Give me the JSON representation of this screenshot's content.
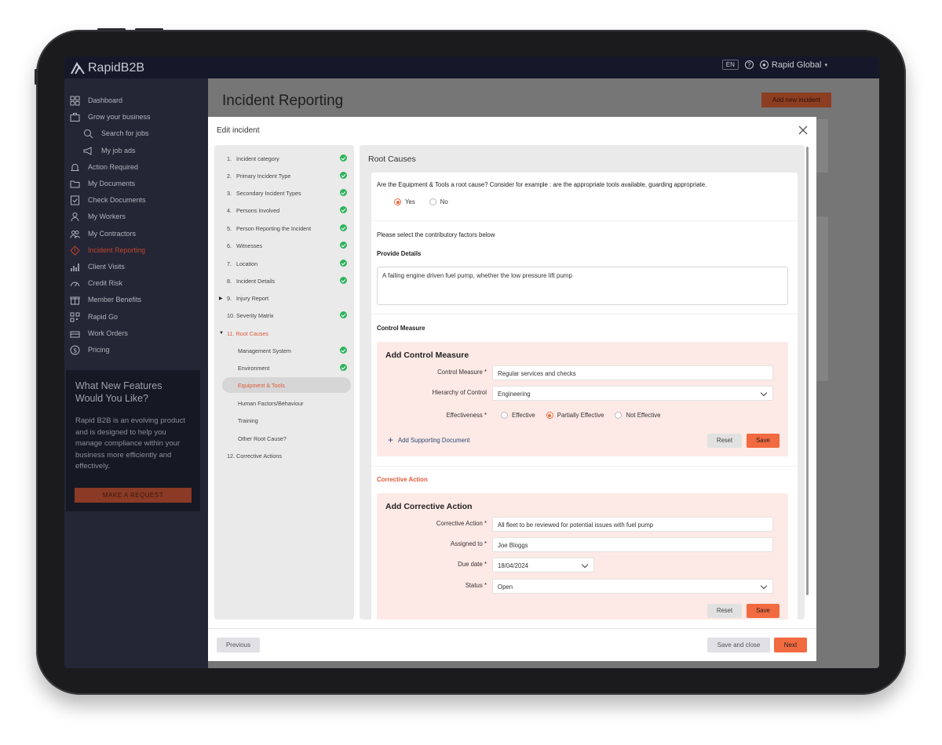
{
  "app": {
    "logo_text": "RapidB2B",
    "lang": "EN",
    "help": "?",
    "account": "Rapid Global"
  },
  "sidebar": {
    "items": [
      {
        "label": "Dashboard"
      },
      {
        "label": "Grow your business"
      },
      {
        "label": "Search for jobs"
      },
      {
        "label": "My job ads"
      },
      {
        "label": "Action Required"
      },
      {
        "label": "My Documents"
      },
      {
        "label": "Check Documents"
      },
      {
        "label": "My Workers"
      },
      {
        "label": "My Contractors"
      },
      {
        "label": "Incident Reporting"
      },
      {
        "label": "Client Visits"
      },
      {
        "label": "Credit Risk"
      },
      {
        "label": "Member Benefits"
      },
      {
        "label": "Rapid Go"
      },
      {
        "label": "Work Orders"
      },
      {
        "label": "Pricing"
      }
    ],
    "promo": {
      "title": "What New Features Would You Like?",
      "body": "Rapid B2B is an evolving product and is designed to help you manage compliance within your business more efficiently and effectively.",
      "button": "MAKE A REQUEST"
    }
  },
  "page": {
    "title": "Incident Reporting",
    "add_button": "Add new incident"
  },
  "modal": {
    "title": "Edit incident",
    "steps": [
      {
        "num": "1.",
        "label": "Incident category"
      },
      {
        "num": "2.",
        "label": "Primary Incident Type"
      },
      {
        "num": "3.",
        "label": "Secondary Incident Types"
      },
      {
        "num": "4.",
        "label": "Persons Involved"
      },
      {
        "num": "5.",
        "label": "Person Reporting the Incident"
      },
      {
        "num": "6.",
        "label": "Witnesses"
      },
      {
        "num": "7.",
        "label": "Location"
      },
      {
        "num": "8.",
        "label": "Incident Details"
      },
      {
        "num": "9.",
        "label": "Injury Report"
      },
      {
        "num": "10.",
        "label": "Severity Matrix"
      },
      {
        "num": "11.",
        "label": "Root Causes"
      },
      {
        "num": "",
        "label": "Management System"
      },
      {
        "num": "",
        "label": "Environment"
      },
      {
        "num": "",
        "label": "Equipment & Tools"
      },
      {
        "num": "",
        "label": "Human Factors/Behaviour"
      },
      {
        "num": "",
        "label": "Training"
      },
      {
        "num": "",
        "label": "Other Root Cause?"
      },
      {
        "num": "12.",
        "label": "Corrective Actions"
      }
    ],
    "form": {
      "section_title": "Root Causes",
      "question": "Are the Equipment & Tools a root cause? Consider for example : are the appropriate tools available, guarding appropriate.",
      "yes": "Yes",
      "no": "No",
      "contributory": "Please select the contributory factors below",
      "provide_details": "Provide Details",
      "details_value": "A failing engine driven fuel pump, whether the low pressure lift pump",
      "control_measure_heading": "Control Measure",
      "control": {
        "title": "Add Control Measure",
        "measure_label": "Control Measure *",
        "measure_value": "Regular services and checks",
        "hierarchy_label": "Hierarchy of Control",
        "hierarchy_value": "Engineering",
        "effectiveness_label": "Effectiveness *",
        "eff_options": [
          "Effective",
          "Partially Effective",
          "Not Effective"
        ],
        "add_doc": "Add Supporting Document",
        "reset": "Reset",
        "save": "Save"
      },
      "corrective_heading": "Corrective Action",
      "corrective": {
        "title": "Add Corrective Action",
        "action_label": "Corrective Action *",
        "action_value": "All fleet to be reviewed for potential issues with fuel pump",
        "assigned_label": "Assigned to *",
        "assigned_value": "Joe Bloggs",
        "due_label": "Due date *",
        "due_value": "18/04/2024",
        "status_label": "Status *",
        "status_value": "Open",
        "reset": "Reset",
        "save": "Save"
      }
    },
    "footer": {
      "previous": "Previous",
      "save_close": "Save and close",
      "next": "Next"
    }
  }
}
